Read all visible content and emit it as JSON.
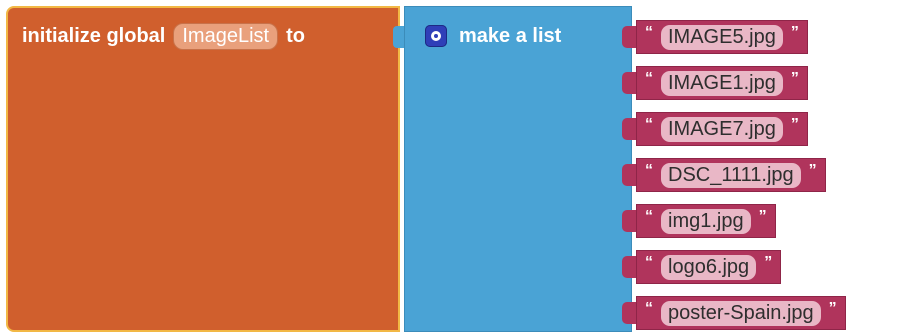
{
  "init_block": {
    "prefix": "initialize global",
    "variable_name": "ImageList",
    "suffix": "to"
  },
  "list_block": {
    "label": "make a list",
    "gear_icon": "gear-icon"
  },
  "items": [
    {
      "value": "IMAGE5.jpg"
    },
    {
      "value": "IMAGE1.jpg"
    },
    {
      "value": "IMAGE7.jpg"
    },
    {
      "value": "DSC_1111.jpg"
    },
    {
      "value": "img1.jpg"
    },
    {
      "value": "logo6.jpg"
    },
    {
      "value": "poster-Spain.jpg"
    }
  ],
  "quote_mark": "“",
  "quote_mark_close": "”",
  "colors": {
    "global_block": "#d05f2d",
    "list_block": "#4aa3d5",
    "string_block": "#b0345c",
    "highlight_border": "#f2b845"
  }
}
